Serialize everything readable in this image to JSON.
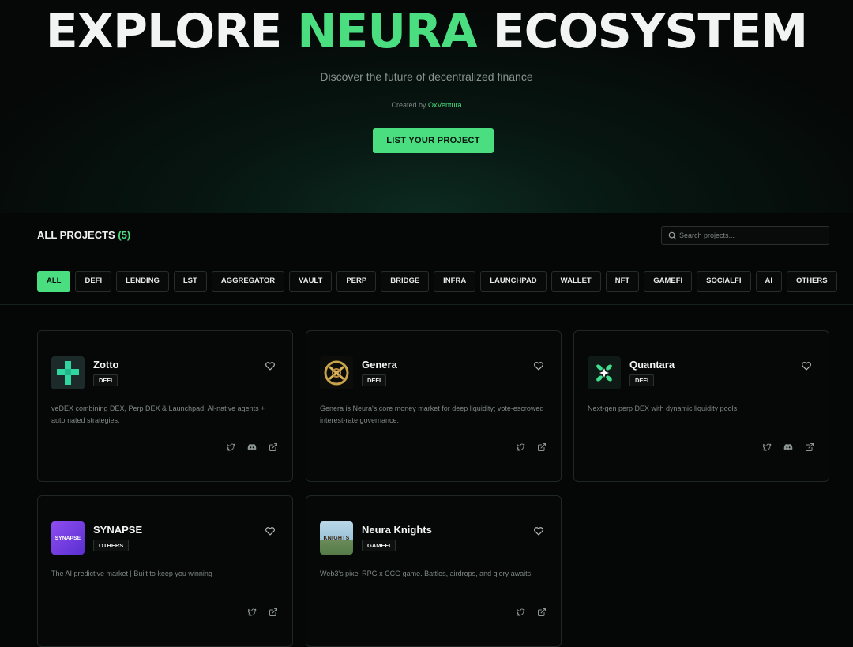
{
  "hero": {
    "title_pre": "EXPLORE",
    "title_accent": "NEURA",
    "title_post": "ECOSYSTEM",
    "subtitle": "Discover the future of decentralized finance",
    "credit_prefix": "Created by",
    "credit_name": "OxVentura",
    "cta_label": "LIST YOUR PROJECT"
  },
  "projects_bar": {
    "title": "ALL PROJECTS",
    "count": "(5)",
    "search_placeholder": "Search projects..."
  },
  "filters": [
    "ALL",
    "DEFI",
    "LENDING",
    "LST",
    "AGGREGATOR",
    "VAULT",
    "PERP",
    "BRIDGE",
    "INFRA",
    "LAUNCHPAD",
    "WALLET",
    "NFT",
    "GAMEFI",
    "SOCIALFI",
    "AI",
    "OTHERS"
  ],
  "active_filter": "ALL",
  "colors": {
    "accent": "#4ade80",
    "background": "#050606"
  },
  "projects": [
    {
      "name": "Zotto",
      "category": "DEFI",
      "description": "veDEX combining DEX, Perp DEX & Launchpad; AI-native agents + automated strategies.",
      "links": [
        "twitter-icon",
        "discord-icon",
        "external-link-icon"
      ]
    },
    {
      "name": "Genera",
      "category": "DEFI",
      "description": "Genera is Neura's core money market for deep liquidity; vote-escrowed interest-rate governance.",
      "links": [
        "twitter-icon",
        "external-link-icon"
      ]
    },
    {
      "name": "Quantara",
      "category": "DEFI",
      "description": "Next-gen perp DEX with dynamic liquidity pools.",
      "links": [
        "twitter-icon",
        "discord-icon",
        "external-link-icon"
      ]
    },
    {
      "name": "SYNAPSE",
      "category": "OTHERS",
      "logo_text": "SYNAPSE",
      "description": "The AI predictive market | Built to keep you winning",
      "links": [
        "twitter-icon",
        "external-link-icon"
      ]
    },
    {
      "name": "Neura Knights",
      "category": "GAMEFI",
      "logo_text": "KNIGHTS",
      "description": "Web3's pixel RPG x CCG game. Battles, airdrops, and glory awaits.",
      "links": [
        "twitter-icon",
        "external-link-icon"
      ]
    }
  ]
}
